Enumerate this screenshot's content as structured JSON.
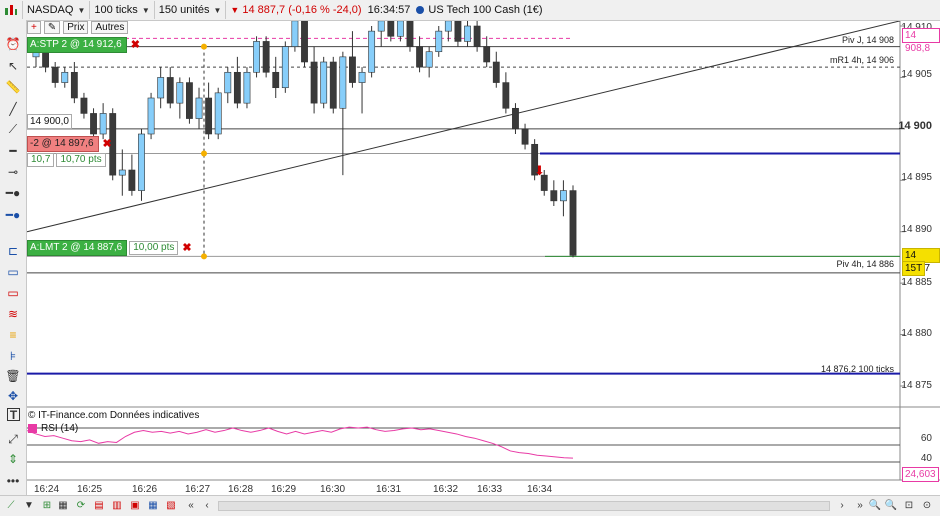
{
  "toolbar": {
    "symbol": "NASDAQ",
    "period": "100 ticks",
    "units": "150 unités",
    "price_change": "14 887,7 (-0,16 % -24,0)",
    "time": "16:34:57",
    "instrument": "US Tech 100 Cash (1€)"
  },
  "subbar": {
    "prix": "Prix",
    "autres": "Autres"
  },
  "orders": {
    "stp": {
      "label": "A:STP 2 @ 14 912,6"
    },
    "position": {
      "label": "-2 @ 14 897,6",
      "v1": "10,7",
      "v2": "10,70 pts"
    },
    "lmt": {
      "label": "A:LMT 2 @ 14 887,6",
      "pts": "10,00 pts"
    },
    "level_14900": "14 900,0"
  },
  "levels": {
    "piv_j": "Piv J, 14 908",
    "mr1": "mR1 4h, 14 906",
    "piv_4h": "Piv 4h, 14 886",
    "ticks100": "14 876,2 100 ticks"
  },
  "price_axis": {
    "ticks": [
      "14 910",
      "14 905",
      "14 900",
      "14 895",
      "14 890",
      "14 885",
      "14 880",
      "14 875"
    ],
    "tag_pink": "14 908,8",
    "tag_current": "14 887,7",
    "tag_tf": "15T"
  },
  "rsi": {
    "label": "RSI (14)",
    "ticks": [
      "60",
      "40",
      "20"
    ],
    "value": "24,603"
  },
  "credit": "© IT-Finance.com  Données indicatives",
  "time_axis": [
    "16:24",
    "16:25",
    "16:26",
    "16:27",
    "16:28",
    "16:29",
    "16:30",
    "16:31",
    "16:32",
    "16:33",
    "16:34"
  ],
  "colors": {
    "up": "#87cefa",
    "down": "#3a3a3a",
    "blue_line": "#1a1aa8",
    "pink": "#e83aa5",
    "green": "#3cb043"
  },
  "chart_data": {
    "type": "candlestick",
    "ylim": [
      14873,
      14911
    ],
    "candles": [
      {
        "o": 14907.0,
        "h": 14908.5,
        "l": 14906.0,
        "c": 14907.5
      },
      {
        "o": 14907.5,
        "h": 14908.0,
        "l": 14905.5,
        "c": 14906.0
      },
      {
        "o": 14906.0,
        "h": 14906.5,
        "l": 14904.0,
        "c": 14904.5
      },
      {
        "o": 14904.5,
        "h": 14906.0,
        "l": 14904.0,
        "c": 14905.5
      },
      {
        "o": 14905.5,
        "h": 14906.5,
        "l": 14902.5,
        "c": 14903.0
      },
      {
        "o": 14903.0,
        "h": 14903.5,
        "l": 14901.0,
        "c": 14901.5
      },
      {
        "o": 14901.5,
        "h": 14902.0,
        "l": 14899.0,
        "c": 14899.5
      },
      {
        "o": 14899.5,
        "h": 14902.5,
        "l": 14899.0,
        "c": 14901.5
      },
      {
        "o": 14901.5,
        "h": 14902.0,
        "l": 14895.0,
        "c": 14895.5
      },
      {
        "o": 14895.5,
        "h": 14898.0,
        "l": 14893.5,
        "c": 14896.0
      },
      {
        "o": 14896.0,
        "h": 14897.5,
        "l": 14893.5,
        "c": 14894.0
      },
      {
        "o": 14894.0,
        "h": 14900.0,
        "l": 14893.0,
        "c": 14899.5
      },
      {
        "o": 14899.5,
        "h": 14903.5,
        "l": 14899.0,
        "c": 14903.0
      },
      {
        "o": 14903.0,
        "h": 14906.0,
        "l": 14902.0,
        "c": 14905.0
      },
      {
        "o": 14905.0,
        "h": 14906.0,
        "l": 14902.0,
        "c": 14902.5
      },
      {
        "o": 14902.5,
        "h": 14905.0,
        "l": 14901.0,
        "c": 14904.5
      },
      {
        "o": 14904.5,
        "h": 14905.0,
        "l": 14900.5,
        "c": 14901.0
      },
      {
        "o": 14901.0,
        "h": 14904.0,
        "l": 14900.0,
        "c": 14903.0
      },
      {
        "o": 14903.0,
        "h": 14904.5,
        "l": 14899.0,
        "c": 14899.5
      },
      {
        "o": 14899.5,
        "h": 14904.0,
        "l": 14899.0,
        "c": 14903.5
      },
      {
        "o": 14903.5,
        "h": 14906.0,
        "l": 14902.5,
        "c": 14905.5
      },
      {
        "o": 14905.5,
        "h": 14907.0,
        "l": 14902.0,
        "c": 14902.5
      },
      {
        "o": 14902.5,
        "h": 14906.0,
        "l": 14902.0,
        "c": 14905.5
      },
      {
        "o": 14905.5,
        "h": 14909.0,
        "l": 14905.0,
        "c": 14908.5
      },
      {
        "o": 14908.5,
        "h": 14909.0,
        "l": 14905.0,
        "c": 14905.5
      },
      {
        "o": 14905.5,
        "h": 14907.0,
        "l": 14903.0,
        "c": 14904.0
      },
      {
        "o": 14904.0,
        "h": 14908.5,
        "l": 14903.5,
        "c": 14908.0
      },
      {
        "o": 14908.0,
        "h": 14911.0,
        "l": 14907.5,
        "c": 14910.5
      },
      {
        "o": 14910.5,
        "h": 14911.0,
        "l": 14906.0,
        "c": 14906.5
      },
      {
        "o": 14906.5,
        "h": 14908.0,
        "l": 14901.5,
        "c": 14902.5
      },
      {
        "o": 14902.5,
        "h": 14907.0,
        "l": 14902.0,
        "c": 14906.5
      },
      {
        "o": 14906.5,
        "h": 14907.0,
        "l": 14901.5,
        "c": 14902.0
      },
      {
        "o": 14902.0,
        "h": 14907.5,
        "l": 14895.5,
        "c": 14907.0
      },
      {
        "o": 14907.0,
        "h": 14909.5,
        "l": 14904.0,
        "c": 14904.5
      },
      {
        "o": 14904.5,
        "h": 14906.0,
        "l": 14901.5,
        "c": 14905.5
      },
      {
        "o": 14905.5,
        "h": 14910.0,
        "l": 14905.0,
        "c": 14909.5
      },
      {
        "o": 14909.5,
        "h": 14911.0,
        "l": 14908.0,
        "c": 14910.5
      },
      {
        "o": 14910.5,
        "h": 14911.0,
        "l": 14908.5,
        "c": 14909.0
      },
      {
        "o": 14909.0,
        "h": 14911.0,
        "l": 14908.5,
        "c": 14910.5
      },
      {
        "o": 14910.5,
        "h": 14911.0,
        "l": 14907.5,
        "c": 14908.0
      },
      {
        "o": 14908.0,
        "h": 14909.0,
        "l": 14905.5,
        "c": 14906.0
      },
      {
        "o": 14906.0,
        "h": 14908.0,
        "l": 14905.0,
        "c": 14907.5
      },
      {
        "o": 14907.5,
        "h": 14910.0,
        "l": 14907.0,
        "c": 14909.5
      },
      {
        "o": 14909.5,
        "h": 14911.0,
        "l": 14908.5,
        "c": 14910.5
      },
      {
        "o": 14910.5,
        "h": 14911.0,
        "l": 14908.0,
        "c": 14908.5
      },
      {
        "o": 14908.5,
        "h": 14911.0,
        "l": 14908.0,
        "c": 14910.0
      },
      {
        "o": 14910.0,
        "h": 14910.5,
        "l": 14907.5,
        "c": 14908.0
      },
      {
        "o": 14908.0,
        "h": 14909.0,
        "l": 14906.0,
        "c": 14906.5
      },
      {
        "o": 14906.5,
        "h": 14907.5,
        "l": 14904.0,
        "c": 14904.5
      },
      {
        "o": 14904.5,
        "h": 14905.5,
        "l": 14901.5,
        "c": 14902.0
      },
      {
        "o": 14902.0,
        "h": 14902.5,
        "l": 14899.5,
        "c": 14900.0
      },
      {
        "o": 14900.0,
        "h": 14900.5,
        "l": 14898.0,
        "c": 14898.5
      },
      {
        "o": 14898.5,
        "h": 14899.0,
        "l": 14895.0,
        "c": 14895.5
      },
      {
        "o": 14895.5,
        "h": 14896.0,
        "l": 14893.5,
        "c": 14894.0
      },
      {
        "o": 14894.0,
        "h": 14895.0,
        "l": 14892.5,
        "c": 14893.0
      },
      {
        "o": 14893.0,
        "h": 14895.0,
        "l": 14891.5,
        "c": 14894.0
      },
      {
        "o": 14894.0,
        "h": 14894.5,
        "l": 14887.5,
        "c": 14887.7
      }
    ],
    "rsi": [
      57,
      53,
      50,
      51,
      48,
      45,
      44,
      46,
      42,
      44,
      43,
      50,
      55,
      57,
      55,
      56,
      54,
      56,
      53,
      55,
      58,
      55,
      57,
      60,
      57,
      55,
      57,
      60,
      56,
      53,
      56,
      53,
      55,
      57,
      55,
      59,
      61,
      60,
      61,
      58,
      56,
      57,
      59,
      60,
      58,
      59,
      57,
      55,
      53,
      50,
      48,
      45,
      42,
      38,
      33,
      31,
      30,
      28,
      27,
      26,
      25,
      24.6
    ]
  }
}
